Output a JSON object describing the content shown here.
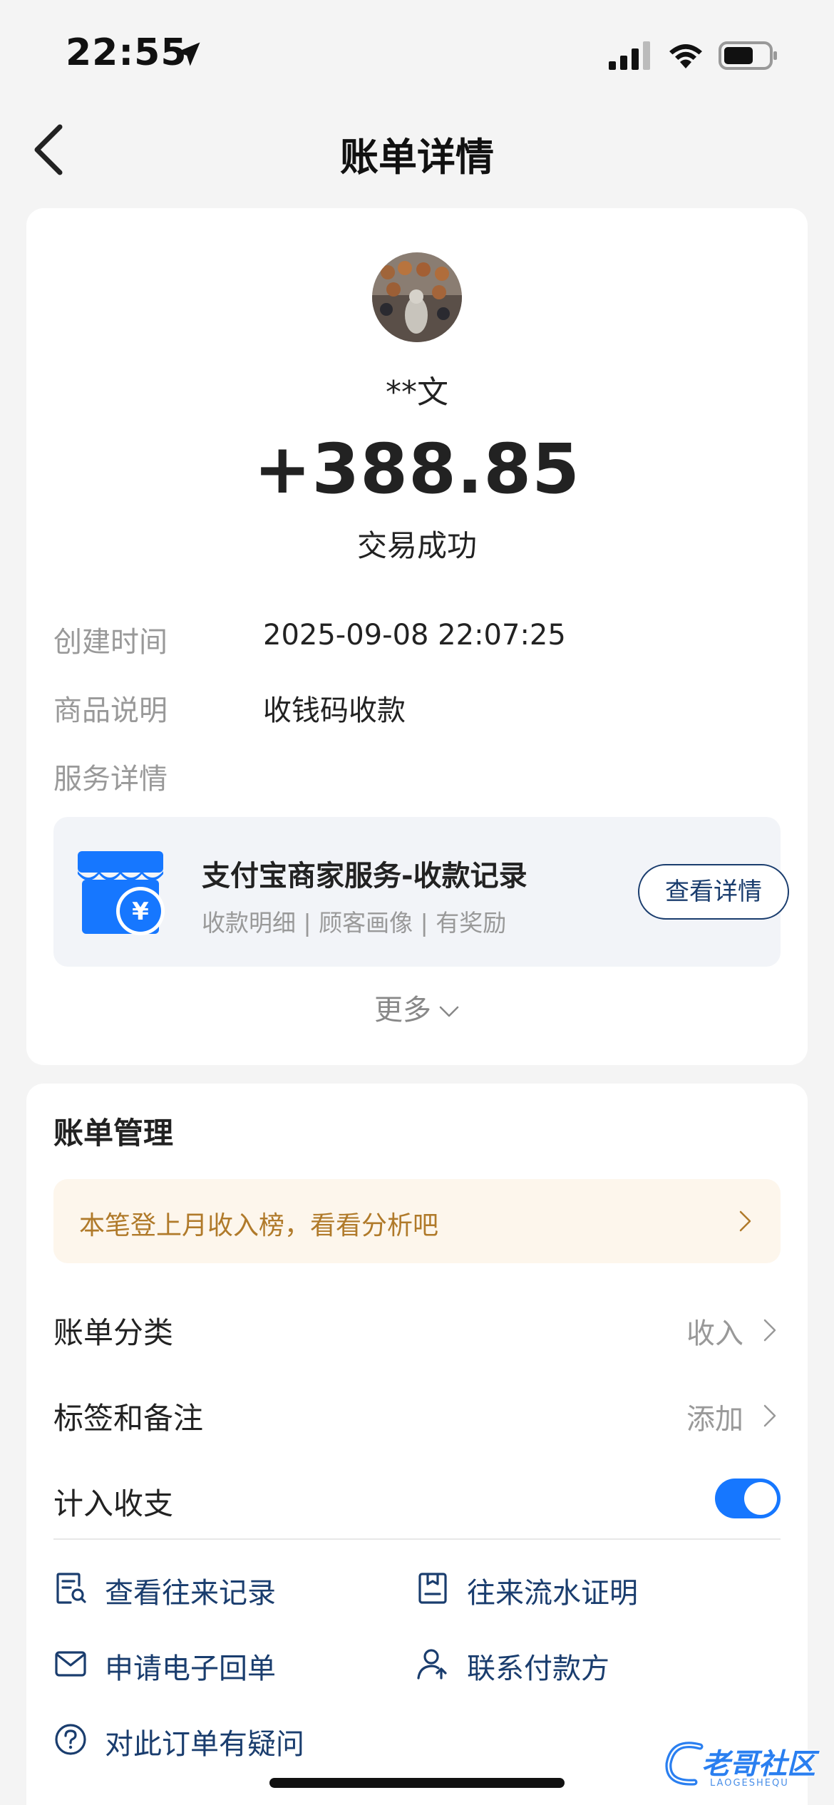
{
  "status_bar": {
    "time": "22:55"
  },
  "nav": {
    "title": "账单详情"
  },
  "transaction": {
    "payer_name": "**文",
    "amount": "+388.85",
    "status": "交易成功"
  },
  "details": {
    "created_label": "创建时间",
    "created_value": "2025-09-08 22:07:25",
    "product_label": "商品说明",
    "product_value": "收钱码收款",
    "service_label": "服务详情"
  },
  "service": {
    "title": "支付宝商家服务-收款记录",
    "subtitle": "收款明细 | 顾客画像 | 有奖励",
    "button": "查看详情"
  },
  "more_label": "更多",
  "management": {
    "title": "账单管理",
    "banner_text": "本笔登上月收入榜，看看分析吧",
    "category_label": "账单分类",
    "category_value": "收入",
    "tags_label": "标签和备注",
    "tags_value": "添加",
    "count_label": "计入收支",
    "count_enabled": true
  },
  "actions": {
    "view_records": "查看往来记录",
    "flow_proof": "往来流水证明",
    "receipt": "申请电子回单",
    "contact_payer": "联系付款方",
    "question": "对此订单有疑问"
  },
  "watermark": {
    "text": "老哥社区",
    "sub": "LAOGESHEQU"
  },
  "colors": {
    "accent_blue": "#1677ff",
    "link_navy": "#1a3d6e",
    "banner_text": "#b07a2a",
    "banner_bg": "#fdf6ec"
  }
}
